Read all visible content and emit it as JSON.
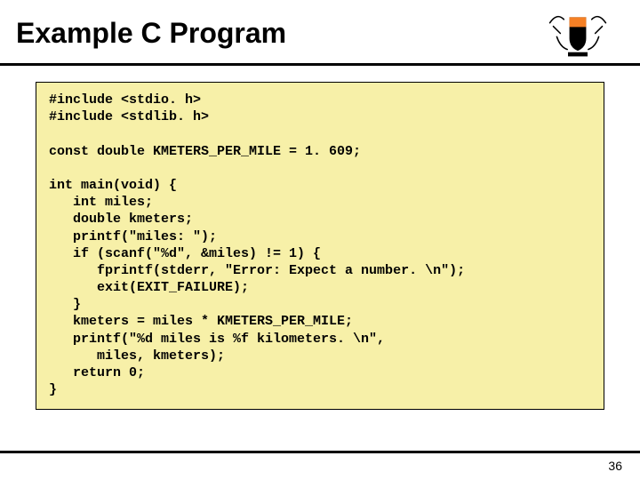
{
  "slide": {
    "title": "Example C Program",
    "page_number": "36"
  },
  "code": {
    "l01": "#include <stdio. h>",
    "l02": "#include <stdlib. h>",
    "l03": "",
    "l04": "const double KMETERS_PER_MILE = 1. 609;",
    "l05": "",
    "l06": "int main(void) {",
    "l07": "   int miles;",
    "l08": "   double kmeters;",
    "l09": "   printf(\"miles: \");",
    "l10": "   if (scanf(\"%d\", &miles) != 1) {",
    "l11": "      fprintf(stderr, \"Error: Expect a number. \\n\");",
    "l12": "      exit(EXIT_FAILURE);",
    "l13": "   }",
    "l14": "   kmeters = miles * KMETERS_PER_MILE;",
    "l15": "   printf(\"%d miles is %f kilometers. \\n\",",
    "l16": "      miles, kmeters);",
    "l17": "   return 0;",
    "l18": "}"
  }
}
